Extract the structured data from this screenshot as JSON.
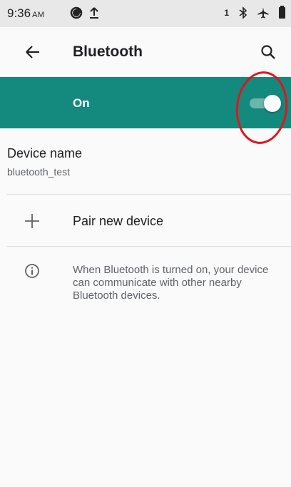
{
  "status_bar": {
    "time": "9:36",
    "ampm": "AM",
    "sim_label": "1",
    "icons": [
      "data-saver-icon",
      "upload-icon",
      "bluetooth-icon",
      "airplane-icon",
      "battery-icon"
    ]
  },
  "app_bar": {
    "title": "Bluetooth",
    "back_icon": "arrow-back-icon",
    "search_icon": "search-icon"
  },
  "toggle": {
    "label": "On",
    "state": true,
    "accent_color": "#138a7d"
  },
  "device_name": {
    "title": "Device name",
    "value": "bluetooth_test"
  },
  "pair_device": {
    "label": "Pair new device",
    "icon": "plus-icon"
  },
  "info": {
    "icon": "info-icon",
    "text": "When Bluetooth is turned on, your device can communicate with other nearby Bluetooth devices."
  },
  "annotation": {
    "color": "#e0141e"
  }
}
